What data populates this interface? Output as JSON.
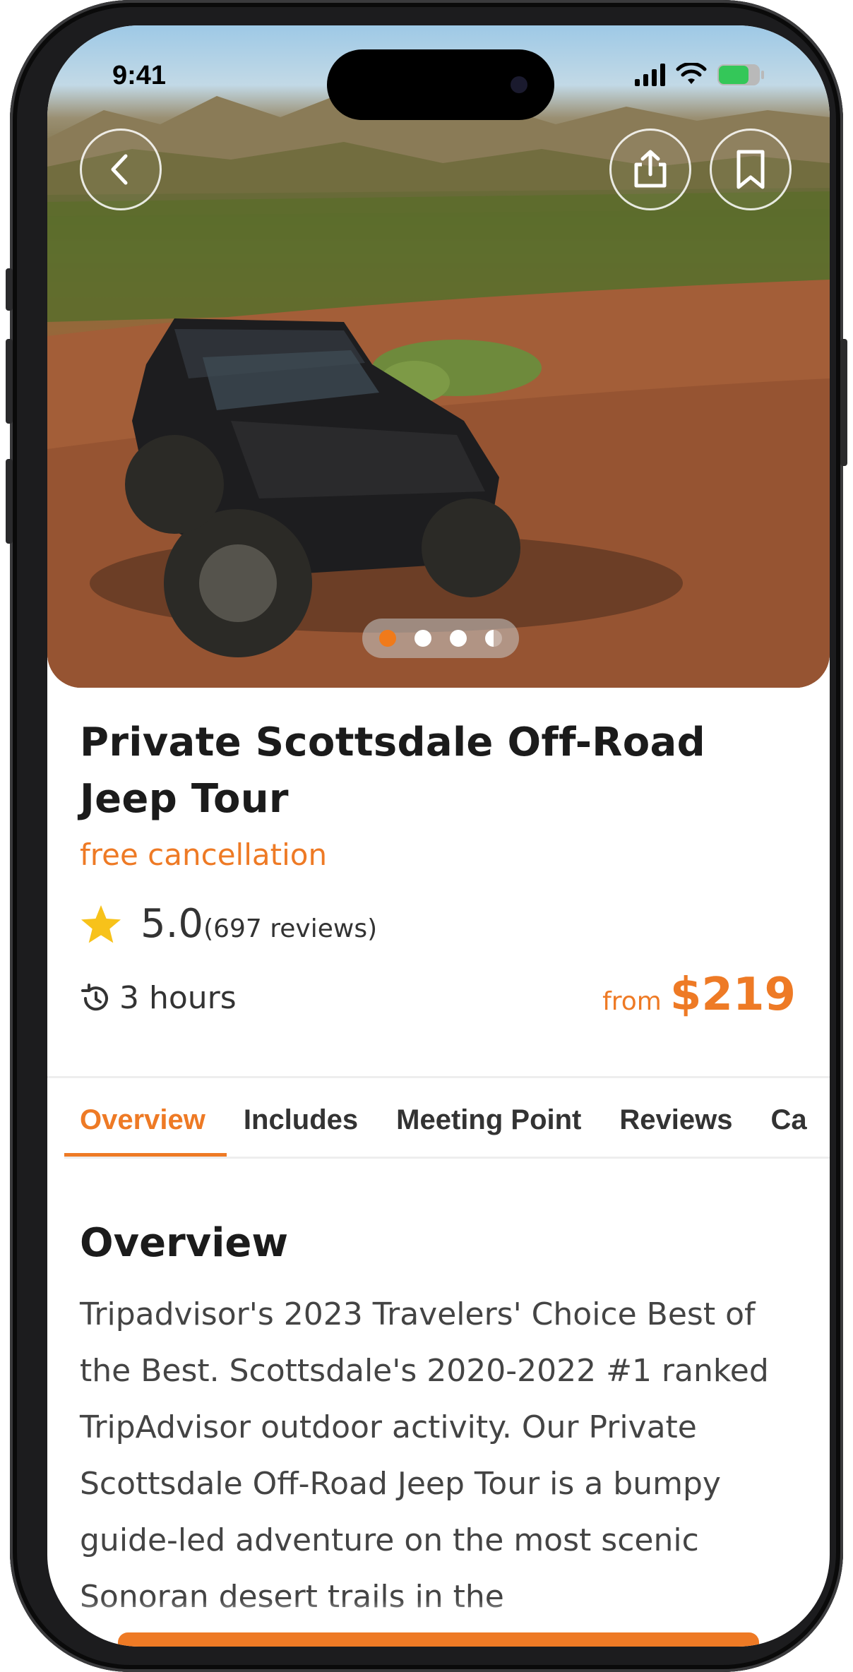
{
  "status_bar": {
    "time": "9:41"
  },
  "hero": {
    "back_icon": "chevron-left-icon",
    "share_icon": "share-icon",
    "bookmark_icon": "bookmark-icon",
    "carousel": {
      "count": 4,
      "active_index": 0
    }
  },
  "tour": {
    "title": "Private Scottsdale Off-Road Jeep Tour",
    "cancellation": "free cancellation",
    "rating": {
      "value": "5.0",
      "count_text": "(697 reviews)",
      "icon": "star-icon"
    },
    "duration": {
      "icon": "history-clock-icon",
      "text": "3 hours"
    },
    "price": {
      "prefix": "from",
      "amount": "$219"
    }
  },
  "tabs": [
    {
      "label": "Overview",
      "active": true
    },
    {
      "label": "Includes",
      "active": false
    },
    {
      "label": "Meeting Point",
      "active": false
    },
    {
      "label": "Reviews",
      "active": false
    },
    {
      "label": "Ca",
      "active": false
    }
  ],
  "overview": {
    "heading": "Overview",
    "text": "Tripadvisor's 2023 Travelers' Choice Best of the Best. Scottsdale's 2020-2022 #1 ranked TripAdvisor outdoor activity. Our Private Scottsdale Off-Road Jeep Tour is a bumpy guide-led adventure on the most scenic Sonoran desert trails in the"
  },
  "colors": {
    "accent": "#ee7a25",
    "text": "#1b1b1b",
    "star": "#f7c21a"
  }
}
